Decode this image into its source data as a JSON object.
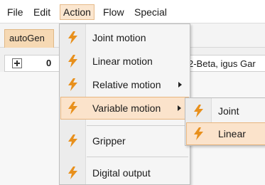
{
  "menubar": {
    "items": [
      "File",
      "Edit",
      "Action",
      "Flow",
      "Special"
    ],
    "active": "Action"
  },
  "tabs": [
    {
      "label": "autoGen"
    }
  ],
  "tree_row": {
    "index": "0",
    "description": "2-Beta, igus Gar"
  },
  "action_menu": {
    "items": [
      {
        "label": "Joint motion",
        "icon": "lightning-icon"
      },
      {
        "label": "Linear motion",
        "icon": "lightning-icon"
      },
      {
        "label": "Relative motion",
        "icon": "lightning-icon",
        "has_submenu": true
      },
      {
        "label": "Variable motion",
        "icon": "lightning-icon",
        "has_submenu": true,
        "highlighted": true
      },
      {
        "label": "Gripper",
        "icon": "lightning-icon"
      },
      {
        "label": "Digital output",
        "icon": "lightning-icon"
      }
    ]
  },
  "variable_motion_submenu": {
    "items": [
      {
        "label": "Joint",
        "icon": "lightning-icon"
      },
      {
        "label": "Linear",
        "icon": "lightning-icon",
        "highlighted": true
      }
    ]
  },
  "colors": {
    "highlight": "#fbe3cb",
    "highlight_border": "#e8b57e",
    "icon_orange": "#e8901c",
    "tab_bg": "#f6d9b4"
  }
}
